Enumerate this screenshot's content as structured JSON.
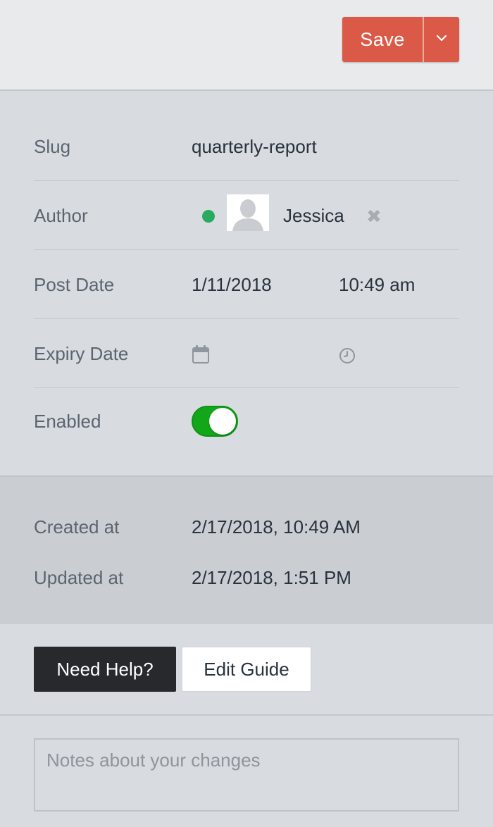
{
  "toolbar": {
    "save_label": "Save",
    "save_color": "#da5a47",
    "dropdown_icon": "chevron-down-icon"
  },
  "fields": {
    "slug": {
      "label": "Slug",
      "value": "quarterly-report"
    },
    "author": {
      "label": "Author",
      "name": "Jessica",
      "status": "online",
      "status_color": "#27ab5e",
      "avatar_icon": "user-silhouette-icon",
      "remove_icon": "close-icon"
    },
    "post_date": {
      "label": "Post Date",
      "date": "1/11/2018",
      "time": "10:49 am"
    },
    "expiry_date": {
      "label": "Expiry Date",
      "date_icon": "calendar-icon",
      "time_icon": "clock-icon"
    },
    "enabled": {
      "label": "Enabled",
      "on": true,
      "toggle_color": "#12a719"
    }
  },
  "timestamps": {
    "created": {
      "label": "Created at",
      "value": "2/17/2018, 10:49 AM"
    },
    "updated": {
      "label": "Updated at",
      "value": "2/17/2018, 1:51 PM"
    }
  },
  "help": {
    "need_help_label": "Need Help?",
    "edit_guide_label": "Edit Guide"
  },
  "notes": {
    "placeholder": "Notes about your changes",
    "value": ""
  }
}
